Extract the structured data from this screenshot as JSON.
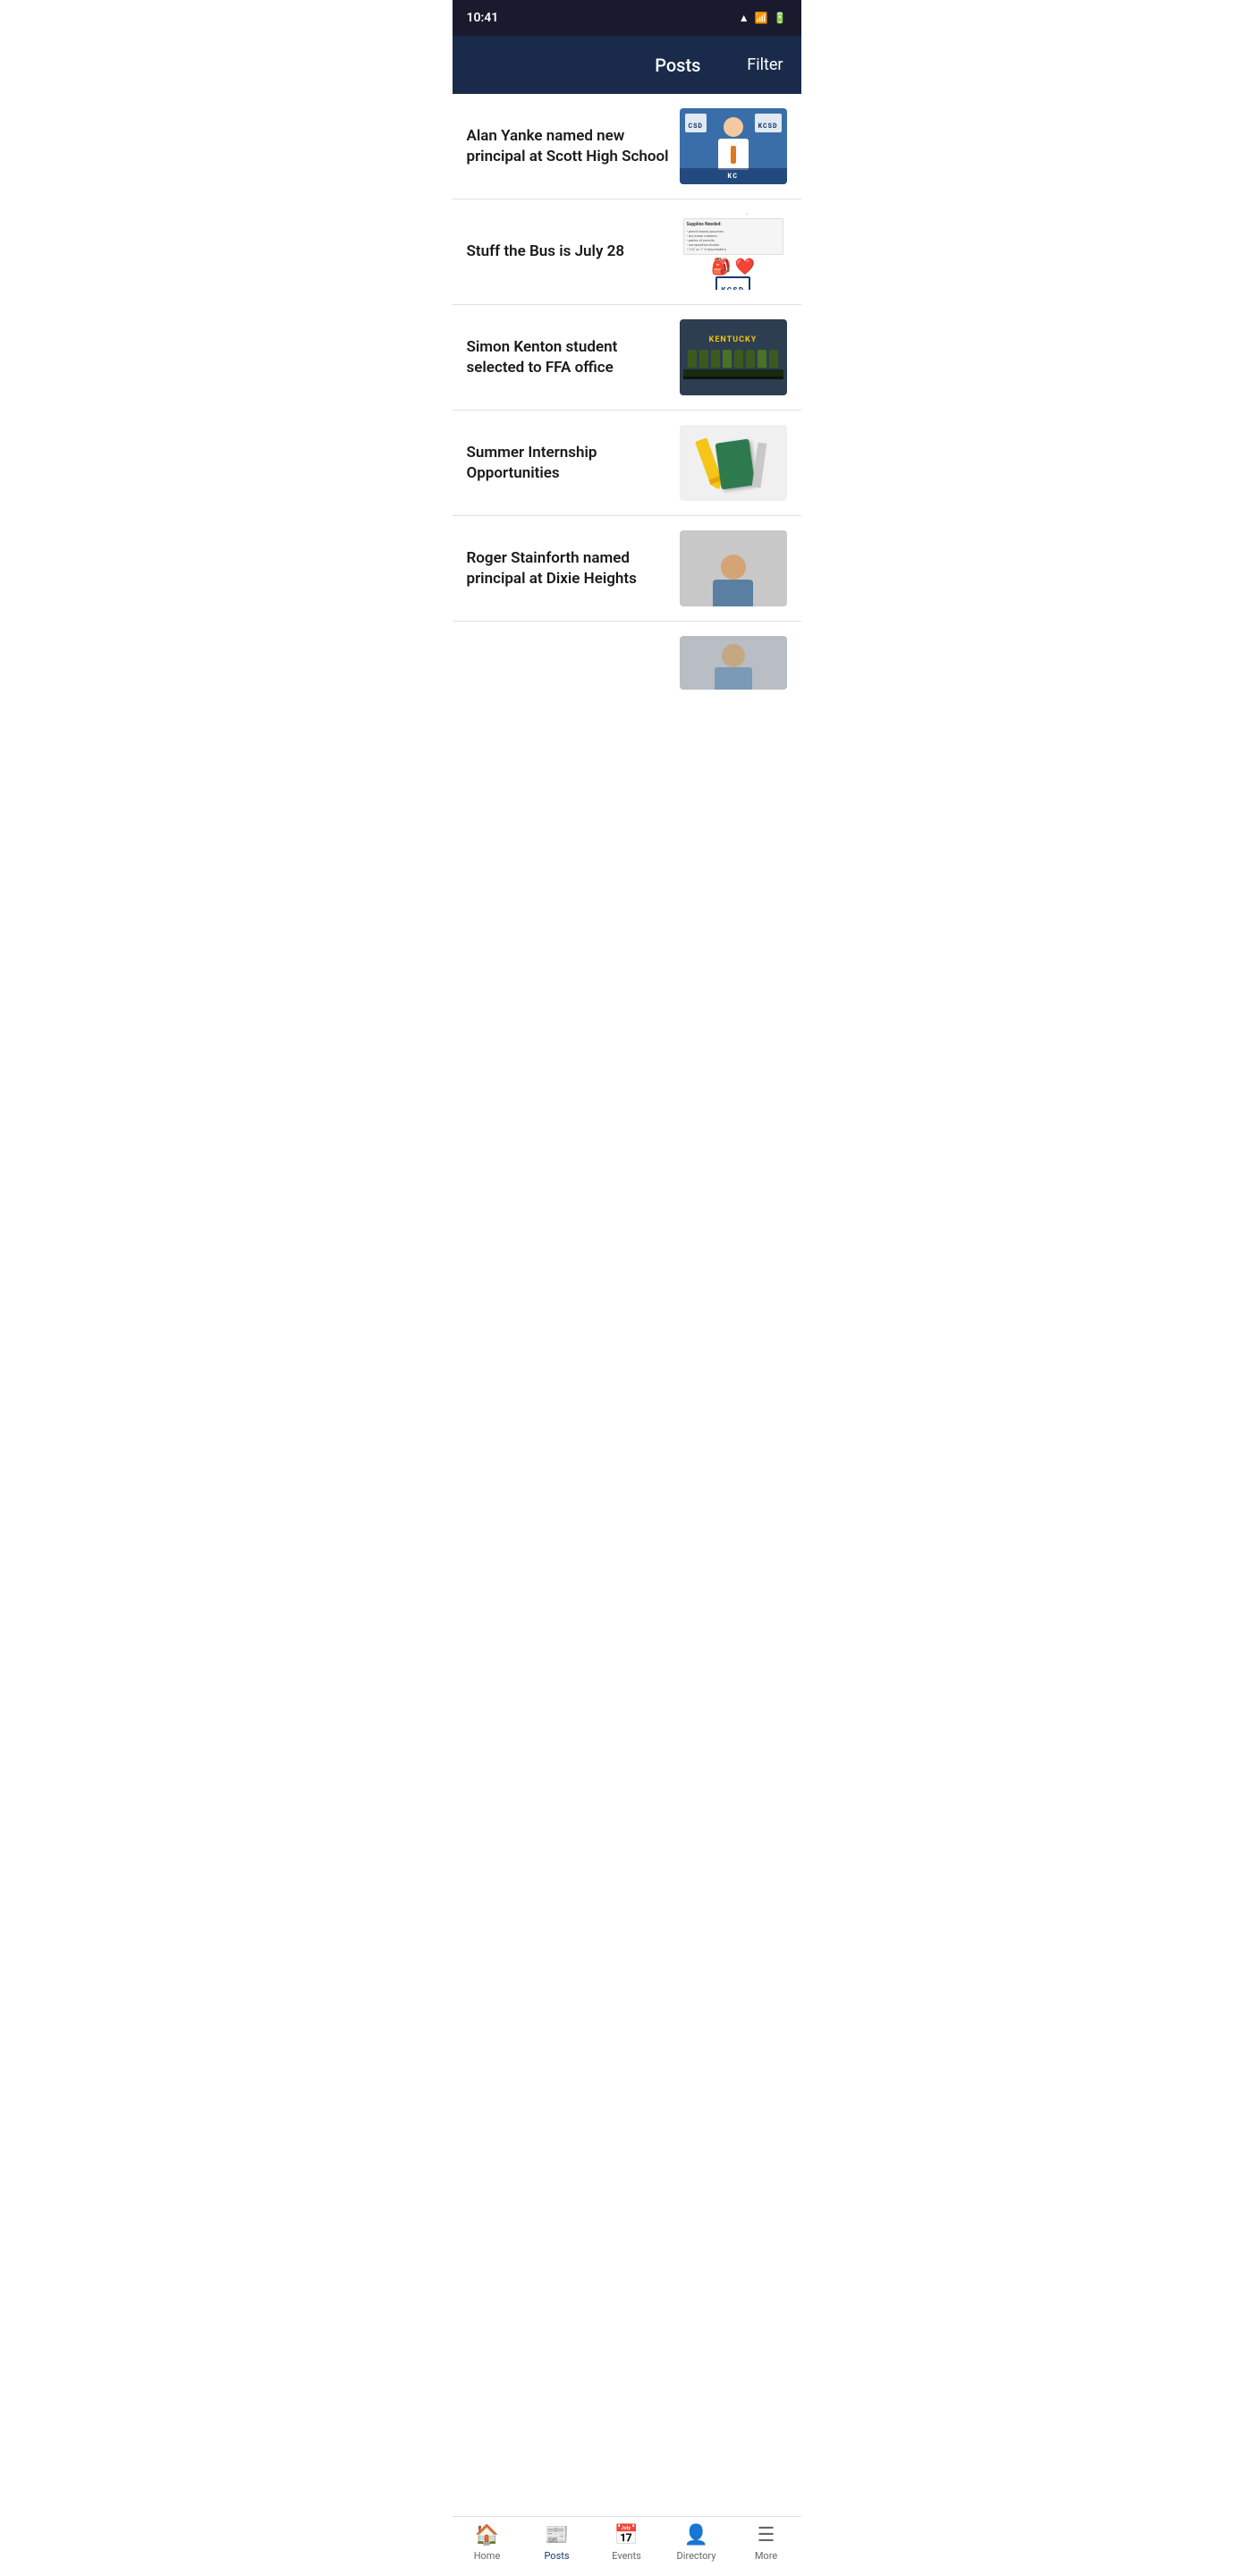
{
  "statusBar": {
    "time": "10:41",
    "icons": [
      "wifi",
      "signal",
      "battery"
    ]
  },
  "header": {
    "title": "Posts",
    "filterLabel": "Filter"
  },
  "posts": [
    {
      "id": 1,
      "title": "Alan Yanke named new principal at Scott High School",
      "thumbType": "alan"
    },
    {
      "id": 2,
      "title": "Stuff the Bus is July 28",
      "thumbType": "bus"
    },
    {
      "id": 3,
      "title": "Simon Kenton student selected to FFA office",
      "thumbType": "ffa"
    },
    {
      "id": 4,
      "title": "Summer Internship Opportunities",
      "thumbType": "internship"
    },
    {
      "id": 5,
      "title": "Roger Stainforth named principal at Dixie Heights",
      "thumbType": "roger"
    }
  ],
  "bottomNav": [
    {
      "id": "home",
      "label": "Home",
      "icon": "🏠",
      "active": false
    },
    {
      "id": "posts",
      "label": "Posts",
      "icon": "📰",
      "active": true
    },
    {
      "id": "events",
      "label": "Events",
      "icon": "📅",
      "active": false
    },
    {
      "id": "directory",
      "label": "Directory",
      "icon": "👤",
      "active": false
    },
    {
      "id": "more",
      "label": "More",
      "icon": "☰",
      "active": false
    }
  ]
}
